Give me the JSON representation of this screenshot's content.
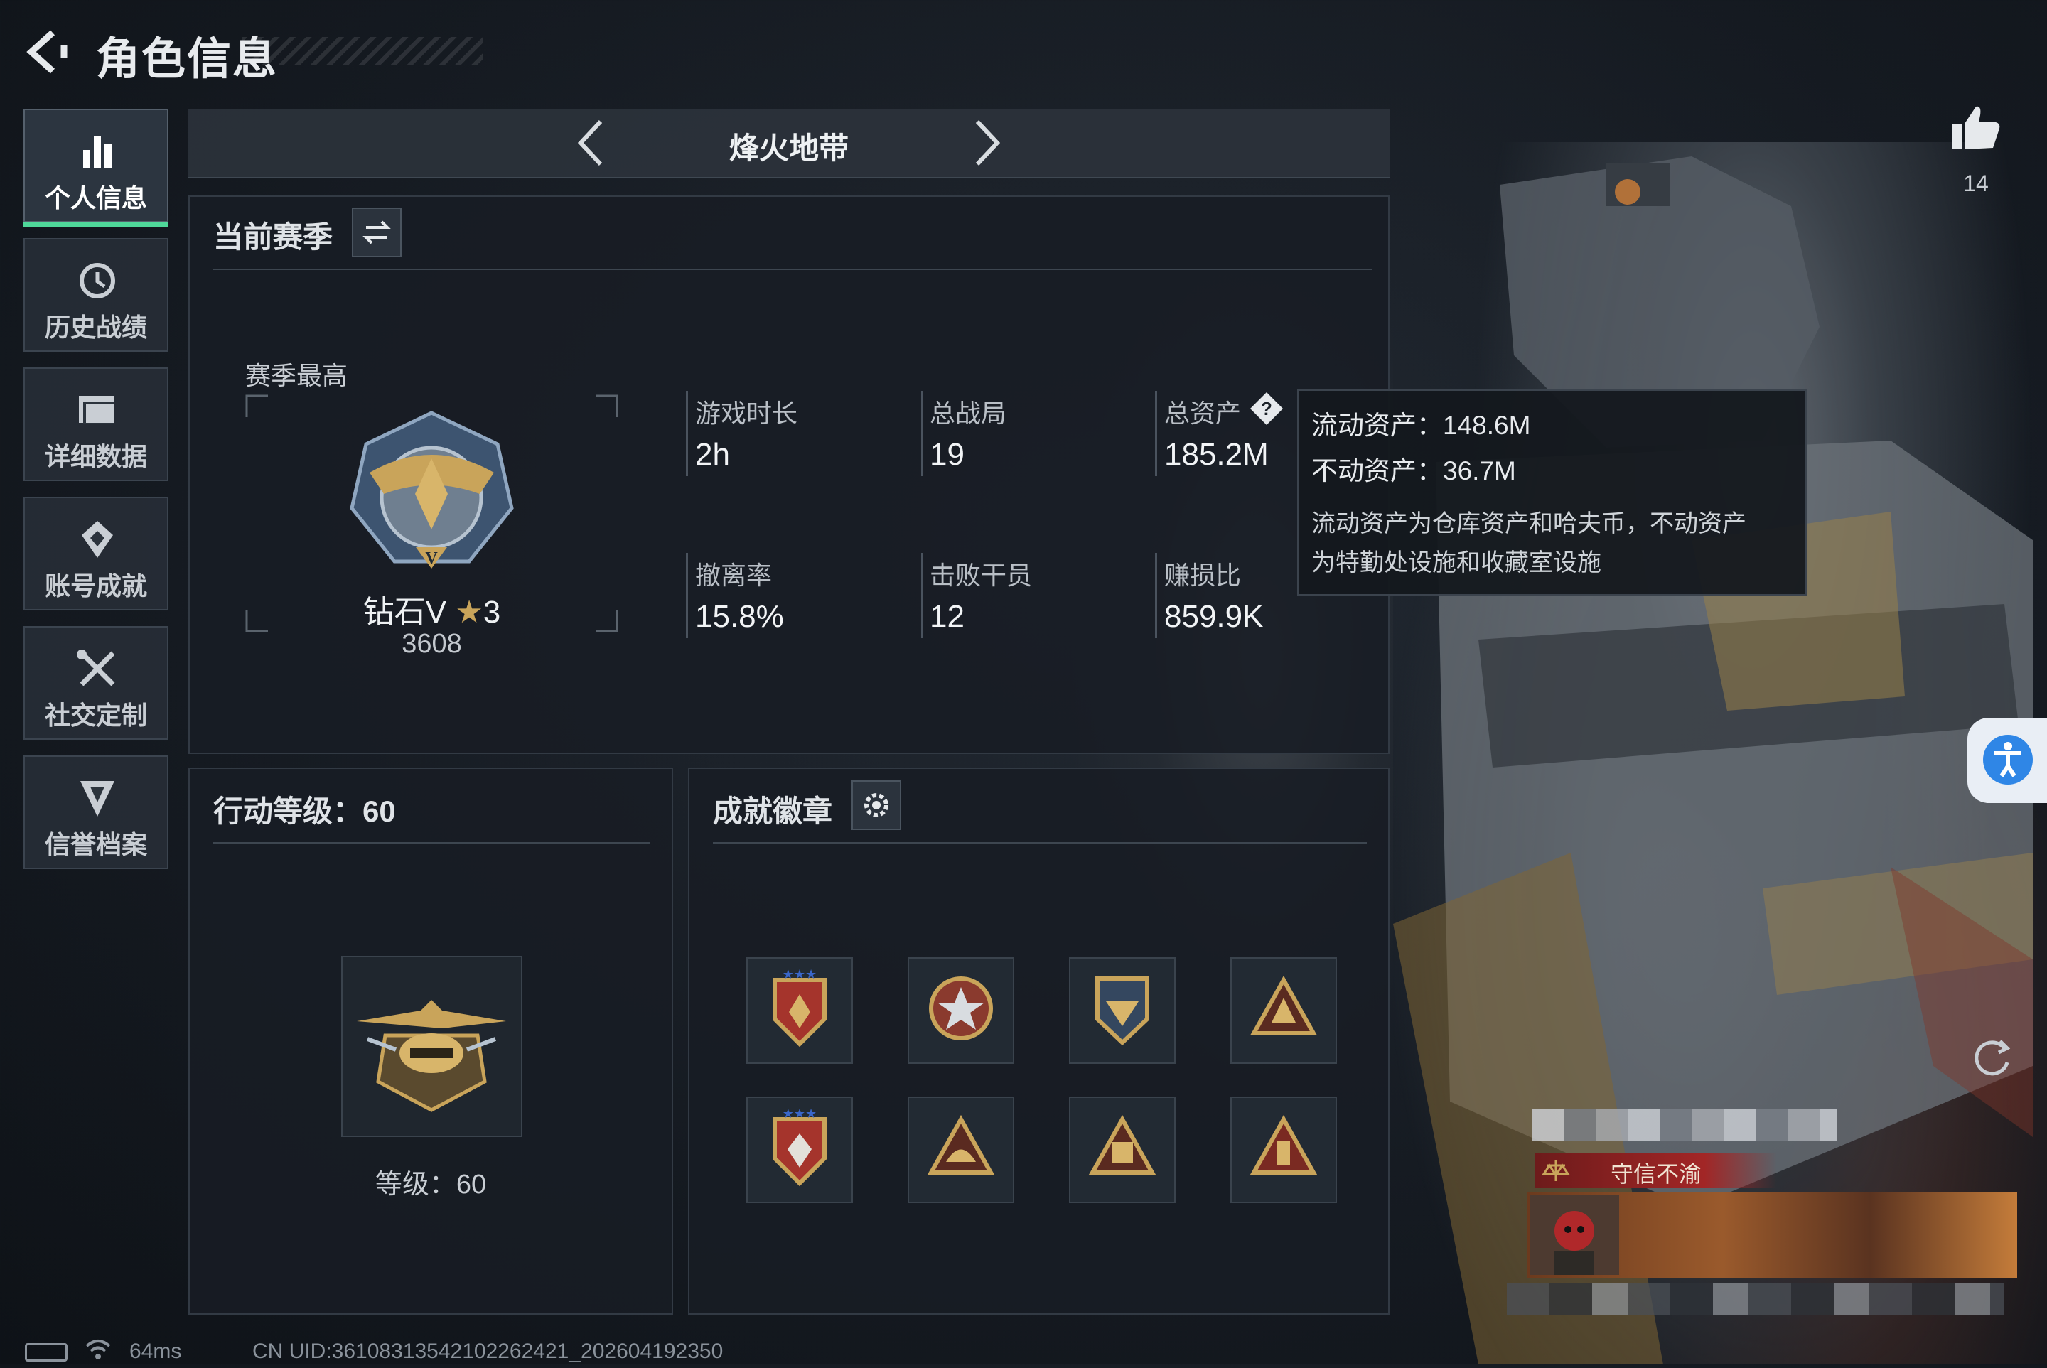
{
  "header": {
    "title": "角色信息"
  },
  "sidebar": {
    "items": [
      {
        "label": "个人信息",
        "icon": "bar-chart-icon",
        "active": true
      },
      {
        "label": "历史战绩",
        "icon": "clock-icon",
        "active": false
      },
      {
        "label": "详细数据",
        "icon": "folder-icon",
        "active": false
      },
      {
        "label": "账号成就",
        "icon": "achievement-icon",
        "active": false
      },
      {
        "label": "社交定制",
        "icon": "tools-icon",
        "active": false
      },
      {
        "label": "信誉档案",
        "icon": "shield-v-icon",
        "active": false
      }
    ]
  },
  "mode": {
    "title": "烽火地带"
  },
  "season": {
    "title": "当前赛季",
    "best_label": "赛季最高",
    "rank_name": "钻石V",
    "rank_stars": "3",
    "rank_score": "3608",
    "stats": [
      {
        "label": "游戏时长",
        "value": "2h"
      },
      {
        "label": "总战局",
        "value": "19"
      },
      {
        "label": "总资产",
        "value": "185.2M"
      },
      {
        "label": "撤离率",
        "value": "15.8%"
      },
      {
        "label": "击败干员",
        "value": "12"
      },
      {
        "label": "赚损比",
        "value": "859.9K"
      }
    ]
  },
  "tooltip": {
    "liquid": "流动资产：148.6M",
    "fixed": "不动资产：36.7M",
    "desc1": "流动资产为仓库资产和哈夫币，不动资产",
    "desc2": "为特勤处设施和收藏室设施"
  },
  "action_level": {
    "title": "行动等级：60",
    "level_text": "等级：60"
  },
  "badges": {
    "title": "成就徽章",
    "items": [
      "badge-1",
      "badge-2",
      "badge-3",
      "badge-4",
      "badge-5",
      "badge-6",
      "badge-7",
      "badge-8"
    ]
  },
  "likes": {
    "count": "14"
  },
  "player_card": {
    "motto": "守信不渝"
  },
  "status_bar": {
    "ping": "64ms",
    "uid": "CN UID:36108313542102262421_202604192350"
  },
  "colors": {
    "accent_green": "#4fd89a",
    "accent_blue": "#2f86e6",
    "gold": "#c9a45a"
  }
}
